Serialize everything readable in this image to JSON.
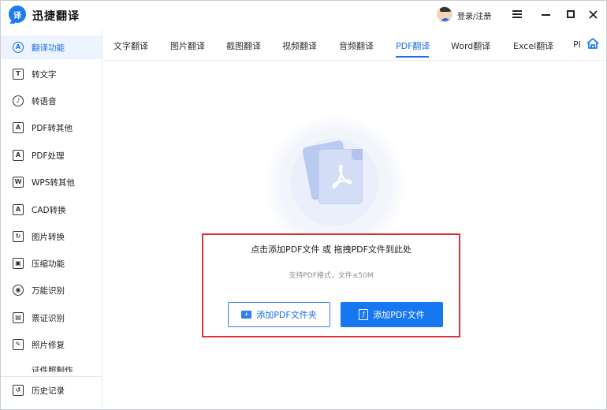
{
  "app": {
    "title": "迅捷翻译",
    "logo_text": "译"
  },
  "header": {
    "login_label": "登录/注册"
  },
  "sidebar": {
    "items": [
      {
        "label": "翻译功能",
        "icon": "translate-icon",
        "glyph": "A"
      },
      {
        "label": "转文字",
        "icon": "text-icon",
        "glyph": "T"
      },
      {
        "label": "转语音",
        "icon": "voice-icon",
        "glyph": "♪"
      },
      {
        "label": "PDF转其他",
        "icon": "pdf-convert-icon",
        "glyph": "A"
      },
      {
        "label": "PDF处理",
        "icon": "pdf-process-icon",
        "glyph": "A"
      },
      {
        "label": "WPS转其他",
        "icon": "wps-convert-icon",
        "glyph": "W"
      },
      {
        "label": "CAD转换",
        "icon": "cad-icon",
        "glyph": "A"
      },
      {
        "label": "图片转换",
        "icon": "image-convert-icon",
        "glyph": "↻"
      },
      {
        "label": "压缩功能",
        "icon": "compress-icon",
        "glyph": "▣"
      },
      {
        "label": "万能识别",
        "icon": "recognize-icon",
        "glyph": "◉"
      },
      {
        "label": "票证识别",
        "icon": "ticket-icon",
        "glyph": "▤"
      },
      {
        "label": "照片修复",
        "icon": "photo-repair-icon",
        "glyph": "✎"
      }
    ],
    "partial_item": {
      "label": "证件照制作"
    },
    "history": {
      "label": "历史记录",
      "icon": "history-icon",
      "glyph": "↺"
    }
  },
  "tabs": {
    "items": [
      "文字翻译",
      "图片翻译",
      "截图翻译",
      "视频翻译",
      "音频翻译",
      "PDF翻译",
      "Word翻译",
      "Excel翻译",
      "PI"
    ],
    "active_index": 5
  },
  "upload": {
    "title": "点击添加PDF文件 或 拖拽PDF文件到此处",
    "subtitle": "支持PDF格式，文件≤50M",
    "add_folder_label": "添加PDF文件夹",
    "add_file_label": "添加PDF文件"
  },
  "colors": {
    "accent": "#1677f0",
    "highlight_border": "#d9353a",
    "doc_blue": "#b9c9ef"
  }
}
